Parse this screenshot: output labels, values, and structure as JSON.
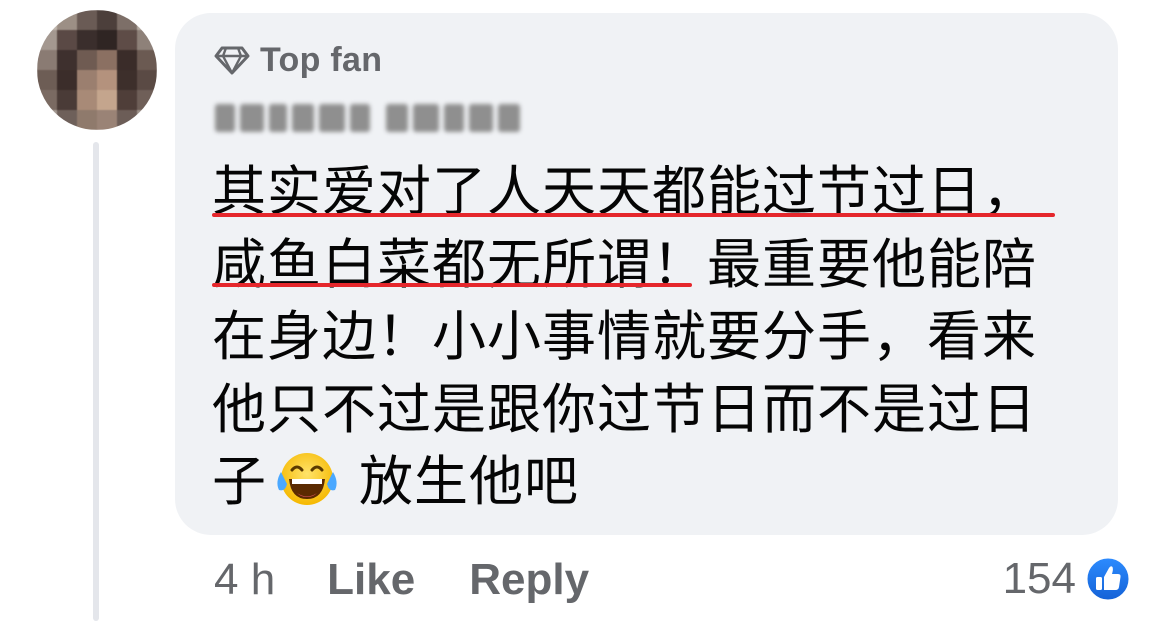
{
  "comment": {
    "badge": {
      "icon": "diamond-icon",
      "label": "Top fan"
    },
    "author": {
      "name_blurred": true
    },
    "text_lines": [
      "其实爱对了人天天都能过节过日，",
      "咸鱼白菜都无所谓！最重要他能陪",
      "在身边！小小事情就要分手，看来",
      "他只不过是跟你过节日而不是过日"
    ],
    "last_line_before": "子",
    "last_line_emoji": "laughing-tears-emoji",
    "last_line_after": "放生他吧",
    "underline_color": "#e5272c"
  },
  "actions": {
    "time": "4 h",
    "like_label": "Like",
    "reply_label": "Reply"
  },
  "reactions": {
    "count": "154",
    "icon": "thumbs-up-icon",
    "badge_color": "#1877f2"
  },
  "colors": {
    "bubble": "#f0f2f5",
    "secondary_text": "#65676b",
    "primary_text": "#050505"
  }
}
